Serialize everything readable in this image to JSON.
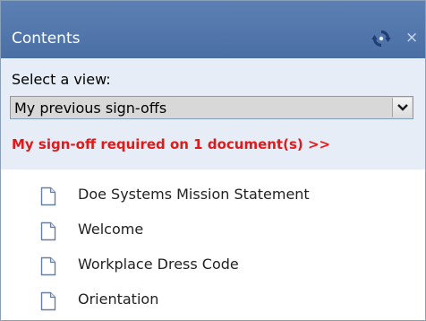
{
  "header": {
    "title": "Contents",
    "refresh_icon": "refresh-icon",
    "close_icon": "close-icon",
    "close_glyph": "×"
  },
  "view": {
    "label": "Select a view:",
    "selected": "My previous sign-offs",
    "dropdown_icon": "chevron-down-icon"
  },
  "signoff": {
    "text": "My sign-off required on 1 document(s) >>",
    "color": "#e01a1a"
  },
  "documents": [
    {
      "label": "Doe Systems Mission Statement",
      "icon": "document-icon"
    },
    {
      "label": "Welcome",
      "icon": "document-icon"
    },
    {
      "label": "Workplace Dress Code",
      "icon": "document-icon"
    },
    {
      "label": "Orientation",
      "icon": "document-icon"
    }
  ],
  "colors": {
    "header_bg": "#4a6fa5",
    "view_bg": "#e6edf6",
    "refresh_dark": "#1f3f74",
    "refresh_light": "#e8f0ff"
  }
}
